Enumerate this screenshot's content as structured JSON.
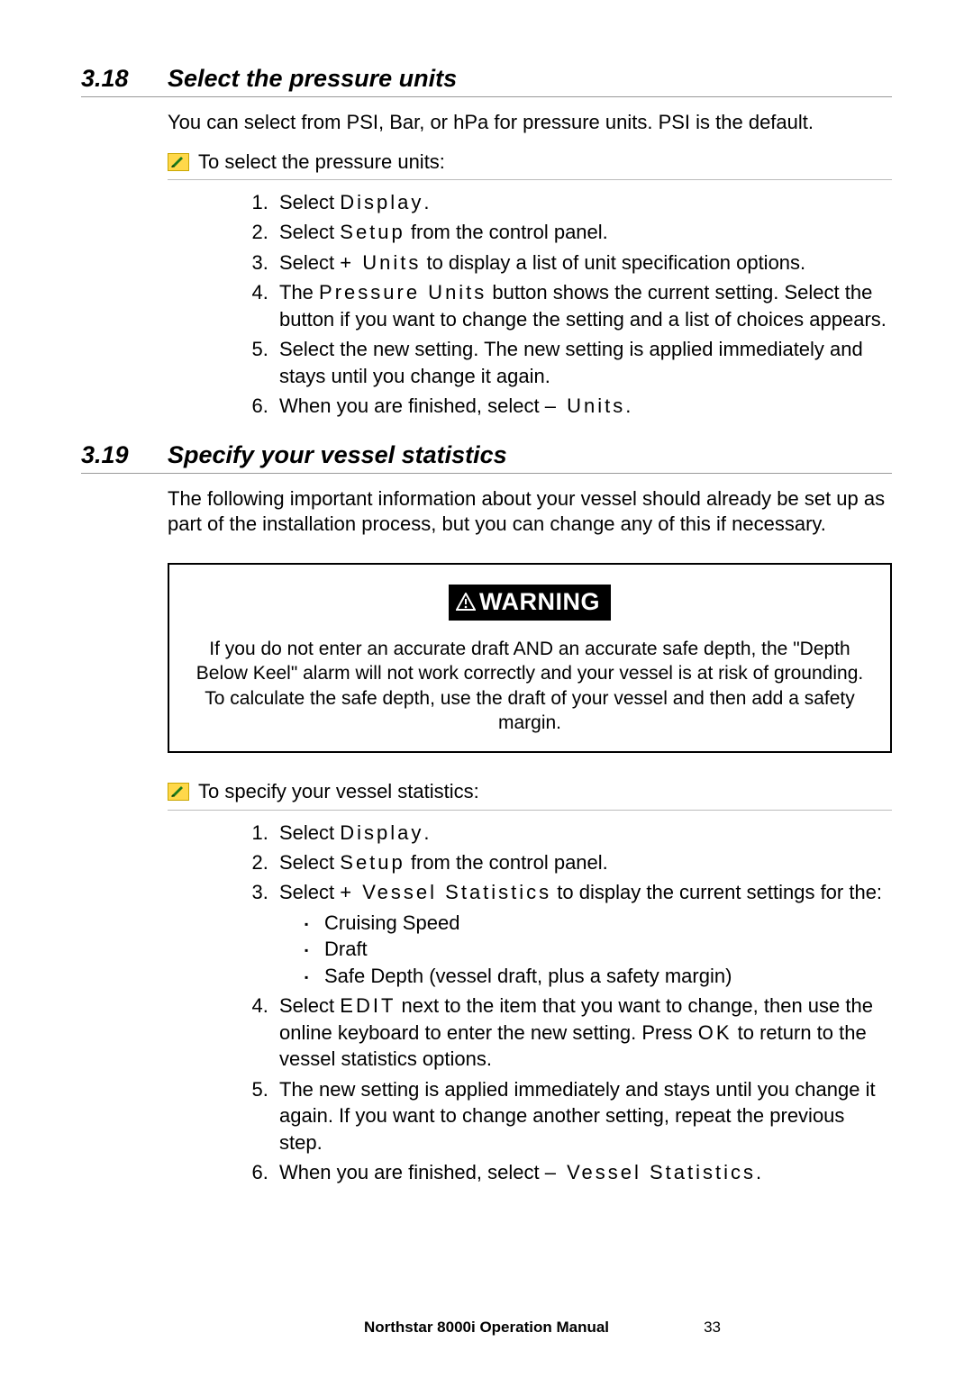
{
  "sections": [
    {
      "number": "3.18",
      "title": "Select the pressure units",
      "intro": "You can select from PSI, Bar, or hPa for pressure units. PSI is the default.",
      "task_label": "To select the pressure units:",
      "steps": [
        {
          "pre": "Select ",
          "term": "Display",
          "post": "."
        },
        {
          "pre": "Select ",
          "term": "Setup",
          "post": " from the control panel."
        },
        {
          "pre": "Select ",
          "term": "+  Units",
          "post": " to display a list of unit specification options."
        },
        {
          "pre": "The ",
          "term": "Pressure Units",
          "post": " button shows the current setting. Select the button if you want to change the setting and a list of choices appears."
        },
        {
          "pre": "Select the new setting. The new setting is applied immediately and stays until you change it again.",
          "term": "",
          "post": ""
        },
        {
          "pre": "When you are finished, select ",
          "term": "–  Units",
          "post": "."
        }
      ]
    },
    {
      "number": "3.19",
      "title": "Specify your vessel statistics",
      "intro": "The following important information about your vessel should already be set up as part of the installation process, but you can change any of this if necessary.",
      "warning": {
        "label": "WARNING",
        "text": "If you do not enter an accurate draft AND an accurate safe depth, the \"Depth Below Keel\" alarm will not work correctly and your vessel is at risk of grounding.  To calculate the safe depth, use the draft of your vessel and then add a safety margin."
      },
      "task_label": "To specify your vessel statistics:",
      "steps": [
        {
          "pre": "Select ",
          "term": "Display",
          "post": "."
        },
        {
          "pre": "Select ",
          "term": "Setup",
          "post": " from the control panel."
        },
        {
          "pre": "Select ",
          "term": "+  Vessel Statistics",
          "post": " to display the current settings for the:",
          "sub": [
            "Cruising Speed",
            "Draft",
            "Safe Depth (vessel draft, plus a safety margin)"
          ]
        },
        {
          "pre": "Select ",
          "term": "EDIT",
          "post_html": " next to the item that you want to change, then use the online keyboard to enter the new setting. Press ",
          "term2": "OK",
          "post2": " to return to the vessel statistics options."
        },
        {
          "pre": "The new setting is applied immediately and stays until you change it again. If you want to change another setting, repeat the previous step.",
          "term": "",
          "post": ""
        },
        {
          "pre": "When you are finished, select ",
          "term": "– Vessel Statistics",
          "post": "."
        }
      ]
    }
  ],
  "footer": {
    "title": "Northstar 8000i Operation Manual",
    "page": "33"
  }
}
